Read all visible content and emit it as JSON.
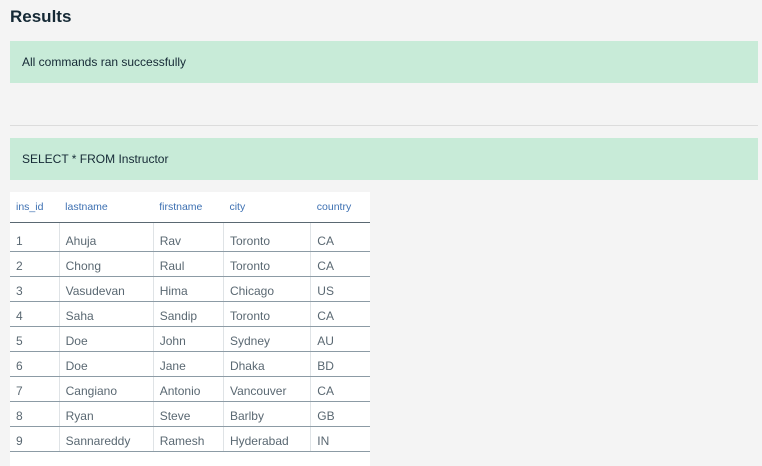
{
  "header": {
    "title": "Results"
  },
  "status": {
    "message": "All commands ran successfully"
  },
  "query": {
    "text": "SELECT * FROM Instructor"
  },
  "table": {
    "columns": [
      "ins_id",
      "lastname",
      "firstname",
      "city",
      "country"
    ],
    "rows": [
      [
        "1",
        "Ahuja",
        "Rav",
        "Toronto",
        "CA"
      ],
      [
        "2",
        "Chong",
        "Raul",
        "Toronto",
        "CA"
      ],
      [
        "3",
        "Vasudevan",
        "Hima",
        "Chicago",
        "US"
      ],
      [
        "4",
        "Saha",
        "Sandip",
        "Toronto",
        "CA"
      ],
      [
        "5",
        "Doe",
        "John",
        "Sydney",
        "AU"
      ],
      [
        "6",
        "Doe",
        "Jane",
        "Dhaka",
        "BD"
      ],
      [
        "7",
        "Cangiano",
        "Antonio",
        "Vancouver",
        "CA"
      ],
      [
        "8",
        "Ryan",
        "Steve",
        "Barlby",
        "GB"
      ],
      [
        "9",
        "Sannareddy",
        "Ramesh",
        "Hyderabad",
        "IN"
      ]
    ]
  },
  "colors": {
    "banner_bg": "#c8ebd8",
    "header_text": "#3d70b2",
    "cell_text": "#5a6872",
    "title_text": "#152935"
  }
}
